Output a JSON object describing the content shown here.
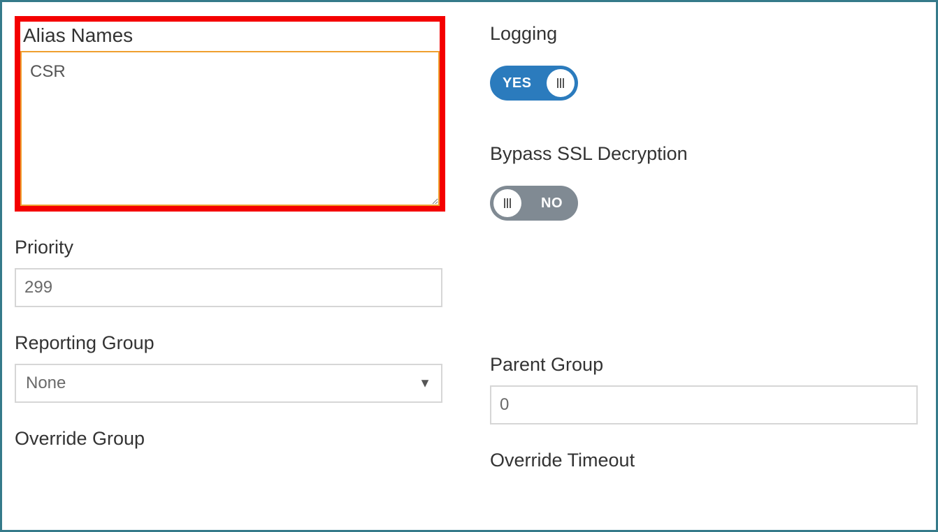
{
  "left": {
    "alias_names": {
      "label": "Alias Names",
      "value": "CSR"
    },
    "priority": {
      "label": "Priority",
      "value": "299"
    },
    "reporting_group": {
      "label": "Reporting Group",
      "selected": "None"
    },
    "override_group": {
      "label": "Override Group"
    }
  },
  "right": {
    "logging": {
      "label": "Logging",
      "state": "on",
      "text": "YES"
    },
    "bypass_ssl": {
      "label": "Bypass SSL Decryption",
      "state": "off",
      "text": "NO"
    },
    "parent_group": {
      "label": "Parent Group",
      "value": "0"
    },
    "override_timeout": {
      "label": "Override Timeout"
    }
  }
}
